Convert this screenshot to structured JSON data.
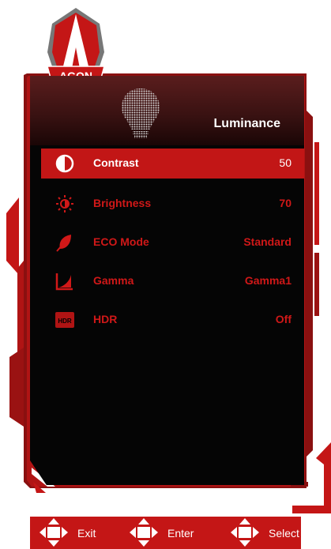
{
  "logo": {
    "text": "AGON"
  },
  "panel": {
    "title": "Luminance"
  },
  "menu": [
    {
      "label": "Contrast",
      "value": "50",
      "icon": "contrast-icon"
    },
    {
      "label": "Brightness",
      "value": "70",
      "icon": "brightness-icon"
    },
    {
      "label": "ECO Mode",
      "value": "Standard",
      "icon": "leaf-icon"
    },
    {
      "label": "Gamma",
      "value": "Gamma1",
      "icon": "gamma-curve-icon"
    },
    {
      "label": "HDR",
      "value": "Off",
      "icon": "hdr-icon"
    }
  ],
  "footer": {
    "exit": "Exit",
    "enter": "Enter",
    "select": "Select"
  },
  "colors": {
    "accent": "#c41616",
    "panel": "#050505",
    "text_inactive": "#d01818"
  }
}
